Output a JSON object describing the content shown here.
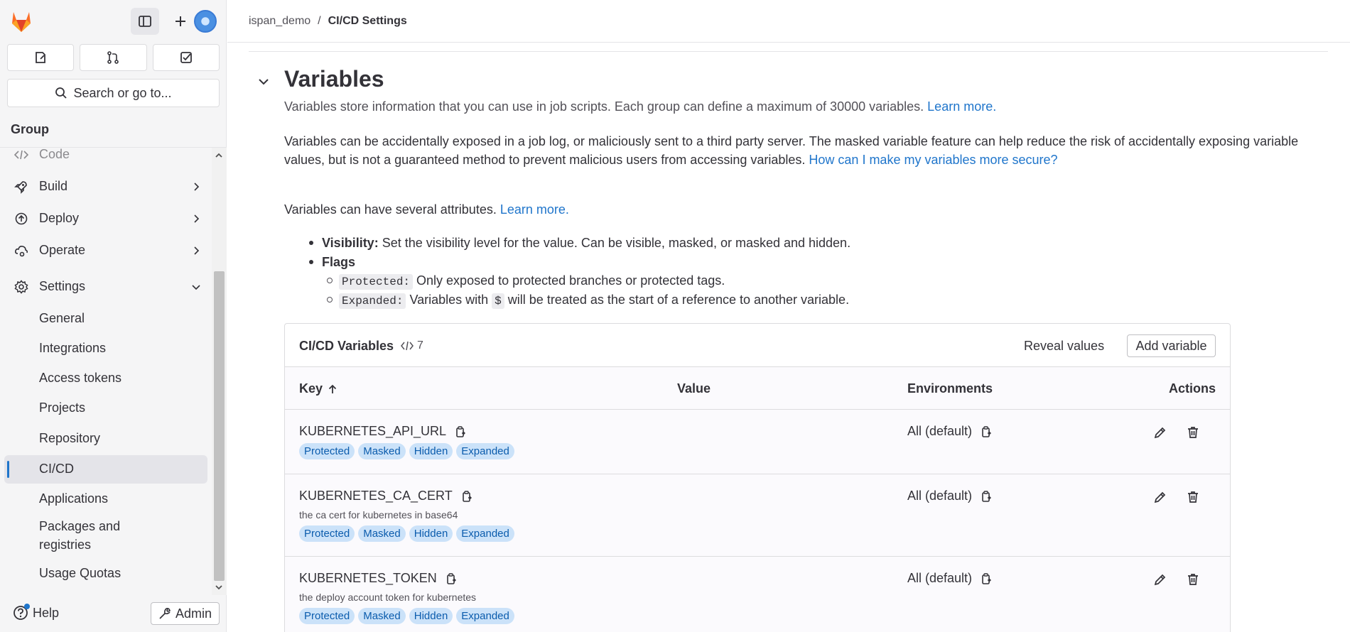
{
  "sidebar": {
    "group_label": "Group",
    "search_label": "Search or go to...",
    "nav": [
      {
        "label": "Code",
        "icon": "code-icon"
      },
      {
        "label": "Build",
        "icon": "rocket-icon"
      },
      {
        "label": "Deploy",
        "icon": "deploy-icon"
      },
      {
        "label": "Operate",
        "icon": "cloud-gear-icon"
      },
      {
        "label": "Settings",
        "icon": "gear-icon"
      }
    ],
    "settings_items": [
      "General",
      "Integrations",
      "Access tokens",
      "Projects",
      "Repository",
      "CI/CD",
      "Applications",
      "Packages and registries",
      "Usage Quotas"
    ],
    "help_label": "Help",
    "admin_label": "Admin"
  },
  "breadcrumb": {
    "parent": "ispan_demo",
    "separator": "/",
    "current": "CI/CD Settings"
  },
  "section": {
    "title": "Variables",
    "intro": "Variables store information that you can use in job scripts. Each group can define a maximum of 30000 variables.",
    "intro_link": "Learn more.",
    "warning": "Variables can be accidentally exposed in a job log, or maliciously sent to a third party server. The masked variable feature can help reduce the risk of accidentally exposing variable values, but is not a guaranteed method to prevent malicious users from accessing variables.",
    "warning_link": "How can I make my variables more secure?",
    "attributes": "Variables can have several attributes.",
    "attributes_link": "Learn more.",
    "visibility_label": "Visibility:",
    "visibility_text": "Set the visibility level for the value. Can be visible, masked, or masked and hidden.",
    "flags_label": "Flags",
    "protected_code": "Protected:",
    "protected_text": "Only exposed to protected branches or protected tags.",
    "expanded_code": "Expanded:",
    "expanded_text_a": "Variables with",
    "dollar_code": "$",
    "expanded_text_b": "will be treated as the start of a reference to another variable."
  },
  "card": {
    "title": "CI/CD Variables",
    "count": "7",
    "reveal_label": "Reveal values",
    "add_label": "Add variable",
    "columns": {
      "key": "Key",
      "value": "Value",
      "environments": "Environments",
      "actions": "Actions"
    },
    "rows": [
      {
        "key": "KUBERNETES_API_URL",
        "description": "",
        "badges": [
          "Protected",
          "Masked",
          "Hidden",
          "Expanded"
        ],
        "environment": "All (default)"
      },
      {
        "key": "KUBERNETES_CA_CERT",
        "description": "the ca cert for kubernetes in base64",
        "badges": [
          "Protected",
          "Masked",
          "Hidden",
          "Expanded"
        ],
        "environment": "All (default)"
      },
      {
        "key": "KUBERNETES_TOKEN",
        "description": "the deploy account token for kubernetes",
        "badges": [
          "Protected",
          "Masked",
          "Hidden",
          "Expanded"
        ],
        "environment": "All (default)"
      }
    ]
  },
  "colors": {
    "accent": "#1f75cb",
    "badge_bg": "#cbe2f9",
    "badge_text": "#0b5cad",
    "sidebar_bg": "#f5f5f6"
  }
}
